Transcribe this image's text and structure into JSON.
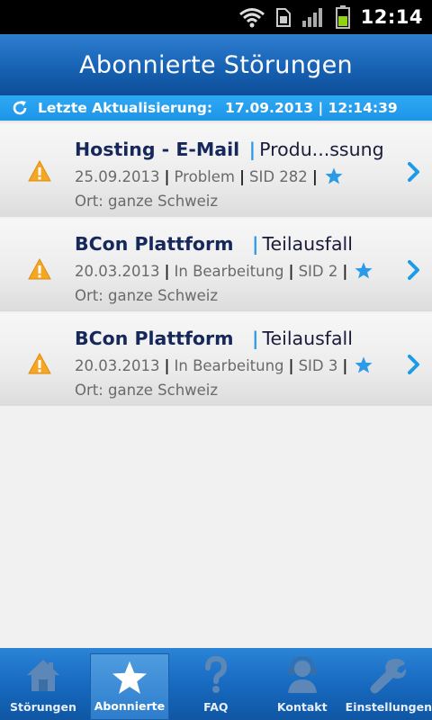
{
  "status_bar": {
    "time": "12:14",
    "icons": [
      "wifi-icon",
      "sim-icon",
      "signal-icon",
      "battery-icon"
    ]
  },
  "header": {
    "title": "Abonnierte Störungen"
  },
  "update_bar": {
    "label": "Letzte Aktualisierung:",
    "value": "17.09.2013 | 12:14:39"
  },
  "items": [
    {
      "name": "Hosting - E-Mail",
      "status": "Produ...ssung",
      "date": "25.09.2013",
      "type": "Problem",
      "sid": "SID 282",
      "location": "Ort: ganze Schweiz",
      "favorite": true
    },
    {
      "name": "BCon Plattform",
      "status": "Teilausfall",
      "date": "20.03.2013",
      "type": "In Bearbeitung",
      "sid": "SID 2",
      "location": "Ort: ganze Schweiz",
      "favorite": true
    },
    {
      "name": "BCon Plattform",
      "status": "Teilausfall",
      "date": "20.03.2013",
      "type": "In Bearbeitung",
      "sid": "SID 3",
      "location": "Ort: ganze Schweiz",
      "favorite": true
    }
  ],
  "tabs": [
    {
      "label": "Störungen",
      "icon": "house-icon",
      "active": false
    },
    {
      "label": "Abonnierte",
      "icon": "star-icon",
      "active": true
    },
    {
      "label": "FAQ",
      "icon": "question-icon",
      "active": false
    },
    {
      "label": "Kontakt",
      "icon": "headset-icon",
      "active": false
    },
    {
      "label": "Einstellungen",
      "icon": "wrench-icon",
      "active": false
    }
  ],
  "colors": {
    "header": "#1762b4",
    "accent": "#2b9be9",
    "warning": "#f5a623",
    "title_text": "#16275c"
  }
}
